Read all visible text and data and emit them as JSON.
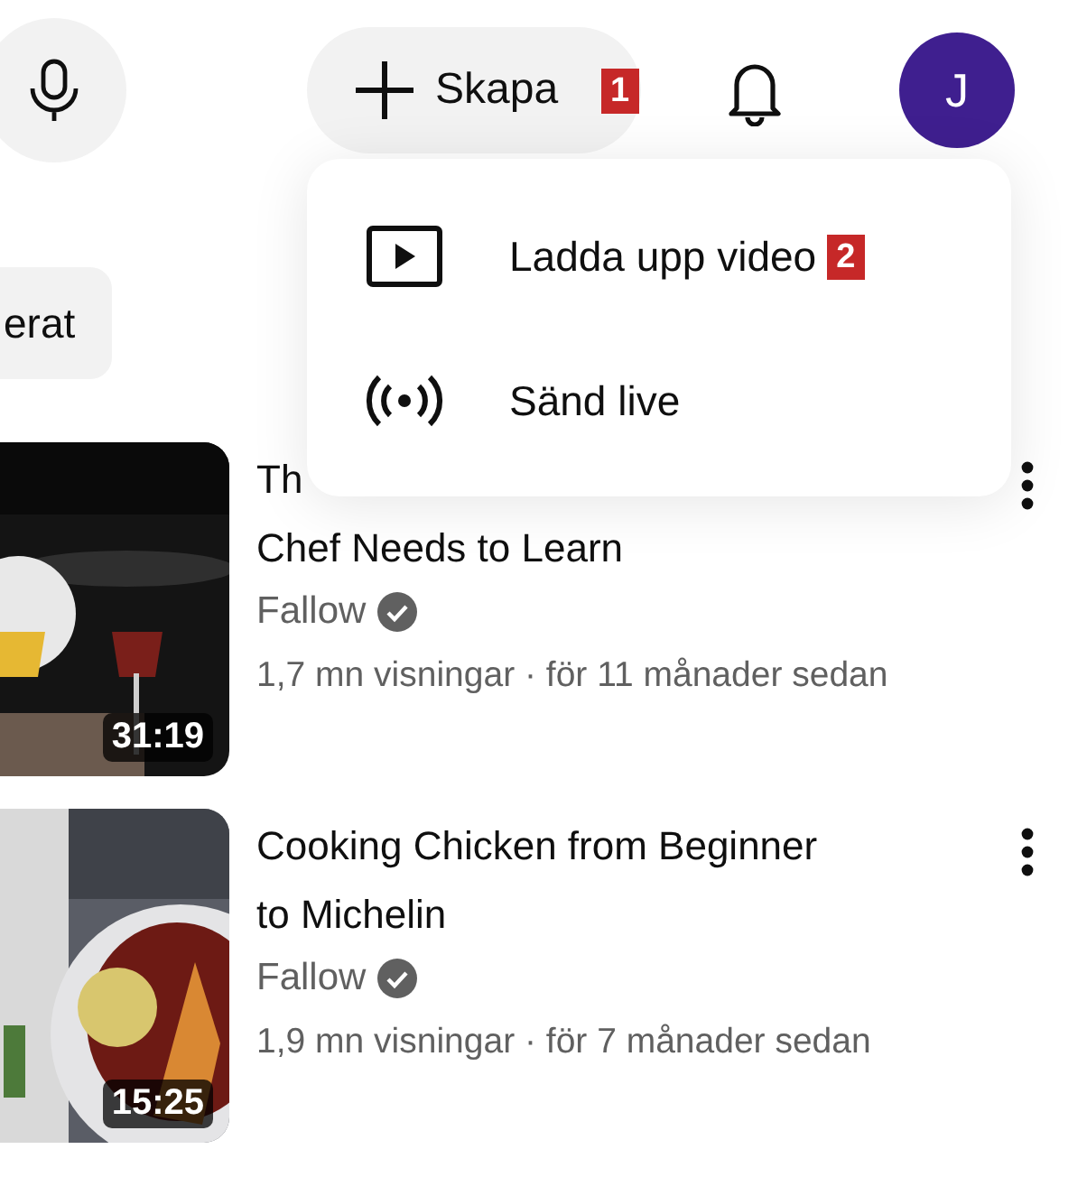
{
  "toolbar": {
    "create_button": {
      "label": "Skapa",
      "marker": "1"
    },
    "avatar": {
      "initial": "J"
    }
  },
  "create_menu": {
    "items": [
      {
        "kind": "upload",
        "label": "Ladda upp video",
        "marker": "2"
      },
      {
        "kind": "live",
        "label": "Sänd live"
      }
    ]
  },
  "filter_chip": {
    "label": "erat"
  },
  "videos": [
    {
      "duration": "31:19",
      "title_lines": [
        "Th",
        "Chef Needs to Learn"
      ],
      "channel": "Fallow",
      "verified": true,
      "meta": "1,7 mn visningar · för 11 månader sedan"
    },
    {
      "duration": "15:25",
      "title_lines": [
        "Cooking Chicken from Beginner",
        "to Michelin"
      ],
      "channel": "Fallow",
      "verified": true,
      "meta": "1,9 mn visningar · för 7 månader sedan"
    }
  ]
}
